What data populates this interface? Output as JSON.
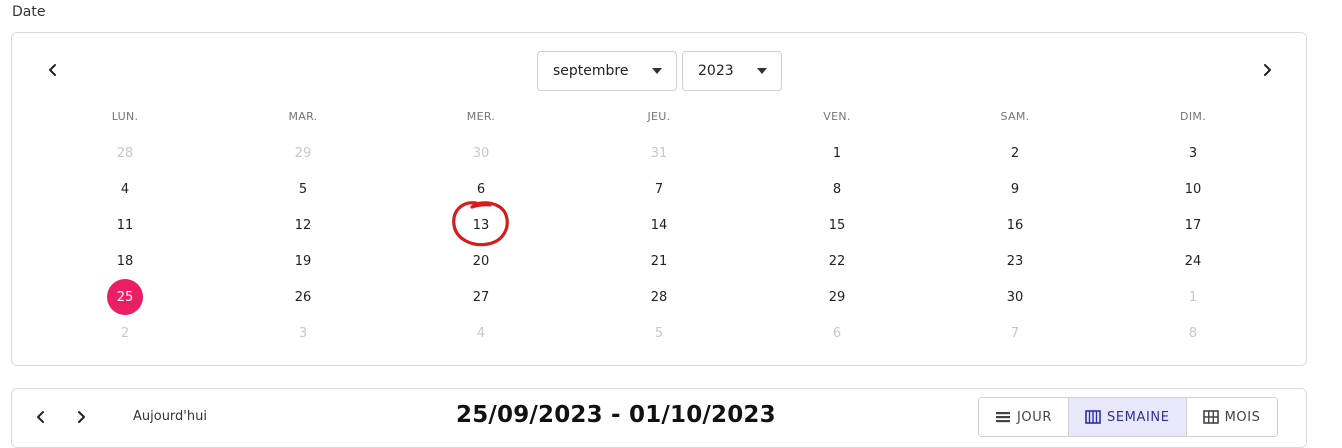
{
  "field_label": "Date",
  "calendar": {
    "month_select": "septembre",
    "year_select": "2023",
    "weekdays": [
      "LUN.",
      "MAR.",
      "MER.",
      "JEU.",
      "VEN.",
      "SAM.",
      "DIM."
    ],
    "weeks": [
      [
        {
          "label": "28",
          "muted": true
        },
        {
          "label": "29",
          "muted": true
        },
        {
          "label": "30",
          "muted": true
        },
        {
          "label": "31",
          "muted": true
        },
        {
          "label": "1",
          "muted": false
        },
        {
          "label": "2",
          "muted": false
        },
        {
          "label": "3",
          "muted": false
        }
      ],
      [
        {
          "label": "4",
          "muted": false
        },
        {
          "label": "5",
          "muted": false
        },
        {
          "label": "6",
          "muted": false
        },
        {
          "label": "7",
          "muted": false
        },
        {
          "label": "8",
          "muted": false
        },
        {
          "label": "9",
          "muted": false
        },
        {
          "label": "10",
          "muted": false
        }
      ],
      [
        {
          "label": "11",
          "muted": false
        },
        {
          "label": "12",
          "muted": false
        },
        {
          "label": "13",
          "muted": false,
          "annotated": true
        },
        {
          "label": "14",
          "muted": false
        },
        {
          "label": "15",
          "muted": false
        },
        {
          "label": "16",
          "muted": false
        },
        {
          "label": "17",
          "muted": false
        }
      ],
      [
        {
          "label": "18",
          "muted": false
        },
        {
          "label": "19",
          "muted": false
        },
        {
          "label": "20",
          "muted": false
        },
        {
          "label": "21",
          "muted": false
        },
        {
          "label": "22",
          "muted": false
        },
        {
          "label": "23",
          "muted": false
        },
        {
          "label": "24",
          "muted": false
        }
      ],
      [
        {
          "label": "25",
          "muted": false,
          "selected": true
        },
        {
          "label": "26",
          "muted": false
        },
        {
          "label": "27",
          "muted": false
        },
        {
          "label": "28",
          "muted": false
        },
        {
          "label": "29",
          "muted": false
        },
        {
          "label": "30",
          "muted": false
        },
        {
          "label": "1",
          "muted": true
        }
      ],
      [
        {
          "label": "2",
          "muted": true
        },
        {
          "label": "3",
          "muted": true
        },
        {
          "label": "4",
          "muted": true
        },
        {
          "label": "5",
          "muted": true
        },
        {
          "label": "6",
          "muted": true
        },
        {
          "label": "7",
          "muted": true
        },
        {
          "label": "8",
          "muted": true
        }
      ]
    ],
    "selected_color": "#e91e63",
    "annotation_color": "#d81b1b"
  },
  "toolbar": {
    "today_label": "Aujourd'hui",
    "range_title": "25/09/2023 - 01/10/2023",
    "views": [
      {
        "label": "JOUR",
        "icon": "list-icon",
        "active": false
      },
      {
        "label": "SEMAINE",
        "icon": "week-columns-icon",
        "active": true
      },
      {
        "label": "MOIS",
        "icon": "month-grid-icon",
        "active": false
      }
    ]
  }
}
